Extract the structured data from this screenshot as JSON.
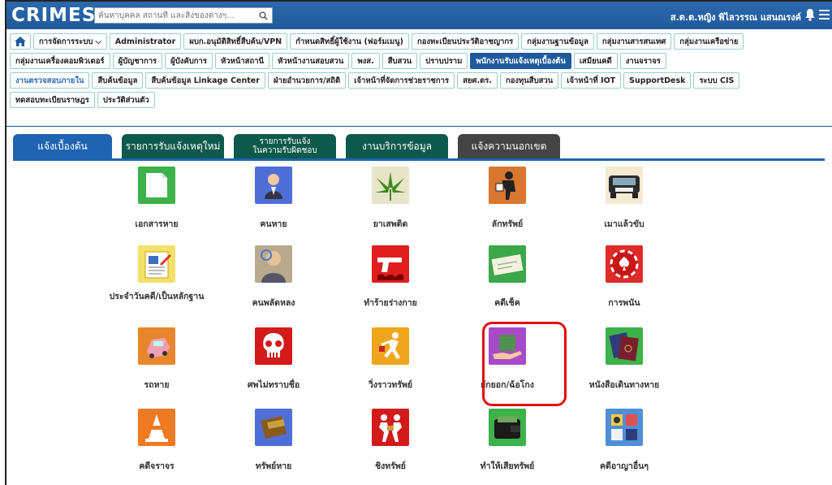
{
  "header": {
    "logo": "CRIMES",
    "search_placeholder": "ค้นหาบุคคล สถานที่ และสิ่งของต่างๆ...",
    "user_name": "ส.ต.ต.หญิง พิไลวรรณ แสนณรงค์"
  },
  "menu_rows": [
    [
      "การจัดการระบบ ⌵",
      "Administrator",
      "ผบก.อนุมัติสิทธิ์สืบค้น/VPN",
      "กำหนดสิทธิ์ผู้ใช้งาน (ฟอร์มเมนู)",
      "กองทะเบียนประวัติอาชญากร",
      "กลุ่มงานฐานข้อมูล",
      "กลุ่มงานสารสนเทศ",
      "กลุ่มงานเครือข่าย"
    ],
    [
      "กลุ่มงานเครื่องคอมพิวเตอร์",
      "ผู้บัญชาการ",
      "ผู้บังคับการ",
      "หัวหน้าสถานี",
      "หัวหน้างานสอบสวน",
      "พงส.",
      "สืบสวน",
      "ปราบปราม",
      "พนักงานรับแจ้งเหตุเบื้องต้น",
      "เสมียนคดี",
      "งานจราจร"
    ],
    [
      "งานตรวจสอบภายใน",
      "สืบค้นข้อมูล",
      "สืบค้นข้อมูล Linkage Center",
      "ฝ่ายอำนวยการ/สถิติ",
      "เจ้าหน้าที่จัดการช่วยราชการ",
      "สยศ.ตร.",
      "กองทุนสืบสวน",
      "เจ้าหน้าที่ IOT",
      "SupportDesk",
      "ระบบ CIS"
    ],
    [
      "ทดสอบทะเบียนราษฎร",
      "ประวัติส่วนตัว"
    ]
  ],
  "active_menu": "พนักงานรับแจ้งเหตุเบื้องต้น",
  "tabs": [
    "แจ้งเบื้องต้น",
    "รายการรับแจ้งเหตุใหม่",
    "รายการรับแจ้ง\nในความรับผิดชอบ",
    "งานบริการข้อมูล",
    "แจ้งความนอกเขต"
  ],
  "items": [
    {
      "label": "เอกสารหาย",
      "icon": "document-icon"
    },
    {
      "label": "คนหาย",
      "icon": "person-icon"
    },
    {
      "label": "ยาเสพติด",
      "icon": "cannabis-icon"
    },
    {
      "label": "ลักทรัพย์",
      "icon": "thief-icon"
    },
    {
      "label": "เมาแล้วขับ",
      "icon": "car-icon"
    },
    {
      "label": "ประจำวันคดี/เป็นหลักฐาน",
      "icon": "notebook-icon"
    },
    {
      "label": "คนพลัดหลง",
      "icon": "lost-person-icon"
    },
    {
      "label": "ทำร้ายร่างกาย",
      "icon": "gun-icon"
    },
    {
      "label": "คดีเช็ค",
      "icon": "check-icon"
    },
    {
      "label": "การพนัน",
      "icon": "casino-chip-icon"
    },
    {
      "label": "รถหาย",
      "icon": "stolen-car-icon"
    },
    {
      "label": "ศพไม่ทราบชื่อ",
      "icon": "skull-icon"
    },
    {
      "label": "วิ่งราวทรัพย์",
      "icon": "snatch-thief-icon"
    },
    {
      "label": "ยักยอก/ฉ้อโกง",
      "icon": "money-hand-icon"
    },
    {
      "label": "หนังสือเดินทางหาย",
      "icon": "passport-icon"
    },
    {
      "label": "คดีจราจร",
      "icon": "traffic-cone-icon"
    },
    {
      "label": "ทรัพย์หาย",
      "icon": "wallet-icon"
    },
    {
      "label": "ชิงทรัพย์",
      "icon": "robbery-icon"
    },
    {
      "label": "ทำให้เสียทรัพย์",
      "icon": "damaged-wallet-icon"
    },
    {
      "label": "คดีอาญาอื่นๆ",
      "icon": "other-cases-icon"
    }
  ],
  "colors": {
    "header": "#1f5a9c",
    "highlight": "#e01010"
  }
}
